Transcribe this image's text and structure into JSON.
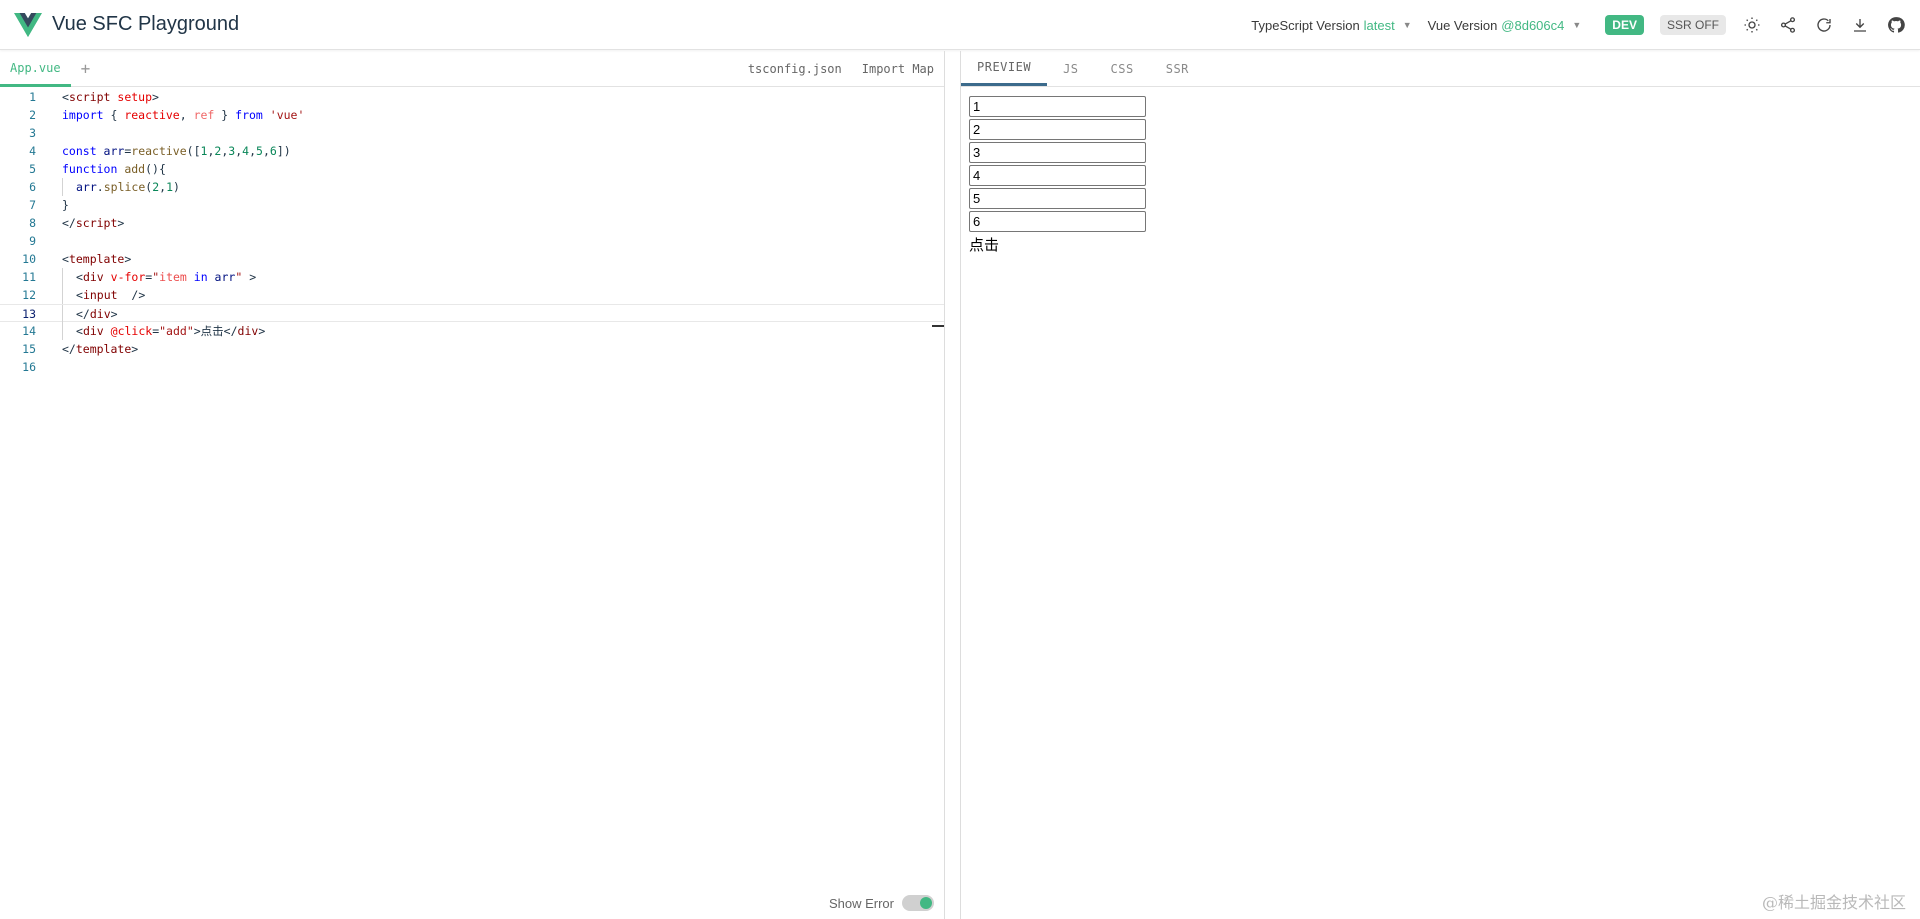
{
  "header": {
    "title": "Vue SFC Playground",
    "typescript_label": "TypeScript Version",
    "typescript_value": "latest",
    "vue_label": "Vue Version",
    "vue_value": "@8d606c4",
    "dev_label": "DEV",
    "ssr_label": "SSR OFF",
    "icons": [
      "theme-toggle-icon",
      "share-icon",
      "reload-icon",
      "download-icon",
      "github-icon"
    ]
  },
  "editor": {
    "tabs": [
      {
        "label": "App.vue"
      }
    ],
    "add_label": "+",
    "right_tabs": [
      {
        "label": "tsconfig.json"
      },
      {
        "label": "Import Map"
      }
    ],
    "line_numbers": [
      "1",
      "2",
      "3",
      "4",
      "5",
      "6",
      "7",
      "8",
      "9",
      "10",
      "11",
      "12",
      "13",
      "14",
      "15",
      "16"
    ],
    "show_error_label": "Show Error"
  },
  "code": {
    "l1_a": "<",
    "l1_b": "script",
    "l1_c": " setup",
    "l1_d": ">",
    "l2_a": "import",
    "l2_b": " { ",
    "l2_c": "reactive",
    "l2_d": ", ",
    "l2_e": "ref",
    "l2_f": " } ",
    "l2_g": "from",
    "l2_h": " 'vue'",
    "l4_a": "const",
    "l4_b": " arr",
    "l4_c": "=",
    "l4_d": "reactive",
    "l4_e": "([",
    "l4_f": "1",
    "l4_g": ",",
    "l4_h": "2",
    "l4_i": ",",
    "l4_j": "3",
    "l4_k": ",",
    "l4_l": "4",
    "l4_m": ",",
    "l4_n": "5",
    "l4_o": ",",
    "l4_p": "6",
    "l4_q": "])",
    "l5_a": "function",
    "l5_b": " add",
    "l5_c": "(){",
    "l6_a": "arr",
    "l6_b": ".",
    "l6_c": "splice",
    "l6_d": "(",
    "l6_e": "2",
    "l6_f": ",",
    "l6_g": "1",
    "l6_h": ")",
    "l7": "}",
    "l8_a": "</",
    "l8_b": "script",
    "l8_c": ">",
    "l10_a": "<",
    "l10_b": "template",
    "l10_c": ">",
    "l11_a": "<",
    "l11_b": "div",
    "l11_c": " v-for",
    "l11_d": "=",
    "l11_e": "\"",
    "l11_f": "item",
    "l11_g": " in ",
    "l11_h": "arr",
    "l11_i": "\"",
    "l11_j": " >",
    "l12_a": "<",
    "l12_b": "input",
    "l12_c": "  />",
    "l13_a": "</",
    "l13_b": "div",
    "l13_c": ">",
    "l14_a": "<",
    "l14_b": "div",
    "l14_c": " @click",
    "l14_d": "=",
    "l14_e": "\"add\"",
    "l14_f": ">点击</",
    "l14_g": "div",
    "l14_h": ">",
    "l15_a": "</",
    "l15_b": "template",
    "l15_c": ">"
  },
  "output": {
    "tabs": [
      {
        "label": "PREVIEW"
      },
      {
        "label": "JS"
      },
      {
        "label": "CSS"
      },
      {
        "label": "SSR"
      }
    ],
    "inputs": [
      "1",
      "2",
      "3",
      "4",
      "5",
      "6"
    ],
    "click_text": "点击"
  },
  "footer": {
    "watermark": "@稀土掘金技术社区"
  },
  "colors": {
    "accent": "#42b883",
    "tab_active_bar": "#3c6b8c"
  }
}
